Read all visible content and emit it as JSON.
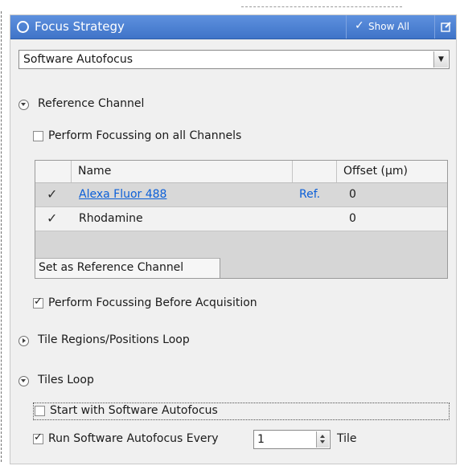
{
  "title_bar": {
    "title": "Focus Strategy",
    "show_all_check": "✓",
    "show_all": "Show All"
  },
  "strategy_select": {
    "value": "Software Autofocus"
  },
  "reference_channel": {
    "header": "Reference Channel",
    "perform_on_all_channels": {
      "label": "Perform Focussing on all Channels",
      "checked": false
    },
    "table": {
      "columns": [
        "",
        "Name",
        "",
        "Offset (µm)"
      ],
      "rows": [
        {
          "check": "✓",
          "name": "Alexa Fluor 488",
          "ref": "Ref.",
          "offset": "0",
          "selected": true,
          "link": true
        },
        {
          "check": "✓",
          "name": "Rhodamine",
          "ref": "",
          "offset": "0",
          "selected": false,
          "link": false
        }
      ],
      "set_reference_button": "Set as Reference Channel"
    },
    "perform_before_acquisition": {
      "label": "Perform Focussing Before Acquisition",
      "checked": true
    }
  },
  "tile_regions_loop": {
    "header": "Tile Regions/Positions Loop",
    "expanded": false
  },
  "tiles_loop": {
    "header": "Tiles Loop",
    "expanded": true,
    "start_with_autofocus": {
      "label": "Start with Software Autofocus",
      "checked": false
    },
    "run_every": {
      "label": "Run Software Autofocus Every",
      "checked": true,
      "value": "1",
      "unit": "Tile"
    }
  },
  "colors": {
    "title_bar": "#4a7fd4",
    "link": "#0b5fd8",
    "panel_bg": "#f0f0f0"
  }
}
